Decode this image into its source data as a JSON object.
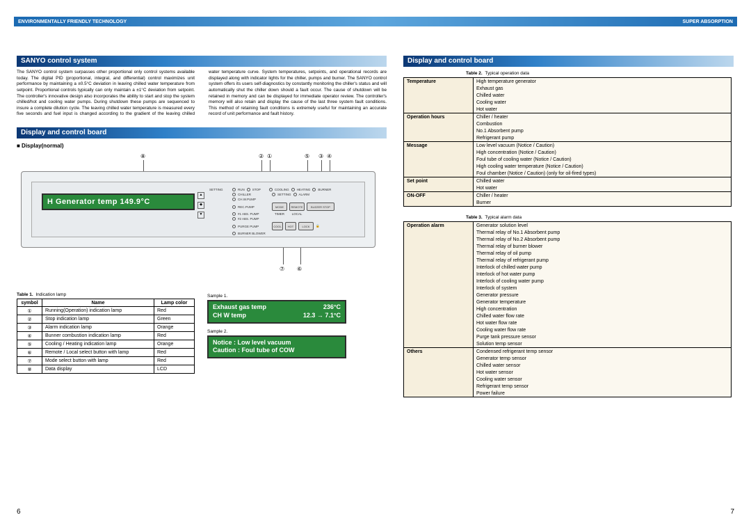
{
  "topbar": {
    "left": "ENVIRONMENTALLY FRIENDLY TECHNOLOGY",
    "right": "SUPER ABSORPTION"
  },
  "left": {
    "sec1_title": "SANYO control system",
    "body": "The SANYO control system surpasses other proportional only control systems available today. The digital PID (proportional, integral, and differential) control maximizes unit performance by maintaining a ±0.5°C deviation in leaving chilled water temperature from setpoint. Proportional controls typically can only maintain a ±1°C deviation from setpoint. The controller's innovative design also incorporates the ability to start and stop the system chilled/hot and cooling water pumps. During shutdown these pumps are sequenced to insure a complete dilution cycle. The leaving chilled water temperature is measured every five seconds and fuel input is changed according to the gradient of the leaving chilled water temperature curve. System temperatures, setpoints, and operational records are displayed along with indicator lights for the chiller, pumps and burner. The SANYO control system offers its users self-diagnostics by constantly monitoring the chiller's status and will automatically shut the chiller down should a fault occur. The cause of shutdown will be retained in memory and can be displayed for immediate operator review. The controller's memory will also retain and display the cause of the last three system fault conditions. This method of retaining fault conditions is extremely useful for maintaining an accurate record of unit performance and fault history.",
    "sec2_title": "Display and control board",
    "display_label": "■ Display(normal)",
    "lcd_main": "H Generator temp   149.9°C",
    "callouts": {
      "c8": "⑧",
      "c2": "②",
      "c1": "①",
      "c5": "⑤",
      "c3": "③",
      "c4": "④",
      "c7": "⑦",
      "c6": "⑥"
    },
    "ctrl_labels": {
      "setting": "SETTING",
      "run": "RUN",
      "stop": "STOP",
      "cooling": "COOLING",
      "heating": "HEATING",
      "burner": "BURNER",
      "chiller": "CHILLER",
      "setting2": "SETTING",
      "alarm": "ALARM",
      "chwpump": "CH.W.PUMP",
      "recpump": "REC.PUMP",
      "mode": "MODE",
      "remote": "REMOTE",
      "buzzer": "BUZZER STOP",
      "abs1": "#1 ABS. PUMP",
      "abs2": "#2 ABS. PUMP",
      "timer": "TIMER",
      "local": "LOCAL",
      "purge": "PURGE PUMP",
      "blower": "BURNER BLOWER",
      "cool": "COOL",
      "hot": "HOT",
      "lock": "LOCK"
    },
    "table1_caption_b": "Table 1.",
    "table1_caption": "Indication lamp",
    "table1_head": [
      "symbol",
      "Name",
      "Lamp color"
    ],
    "table1_rows": [
      [
        "①",
        "Running(Operation) indication lamp",
        "Red"
      ],
      [
        "②",
        "Stop indication lamp",
        "Green"
      ],
      [
        "③",
        "Alarm indication lamp",
        "Orange"
      ],
      [
        "④",
        "Bunner combustion indication lamp",
        "Red"
      ],
      [
        "⑤",
        "Cooling / Heating indication lamp",
        "Orange"
      ],
      [
        "⑥",
        "Remote / Local select button with lamp",
        "Red"
      ],
      [
        "⑦",
        "Mode select button with lamp",
        "Red"
      ],
      [
        "⑧",
        "Data display",
        "LCD"
      ]
    ],
    "sample1": "Sample 1.",
    "lcd_s1_l1a": "Exhaust gas temp",
    "lcd_s1_l1b": "236°C",
    "lcd_s1_l2a": "CH W temp",
    "lcd_s1_l2b": "12.3 → 7.1°C",
    "sample2": "Sample 2.",
    "lcd_s2_l1": "Notice : Low level vacuum",
    "lcd_s2_l2": "Caution : Foul tube of COW"
  },
  "right": {
    "sec_title": "Display and control board",
    "table2_caption_b": "Table 2.",
    "table2_caption": "Typical operation data",
    "table2": [
      {
        "k": "Temperature",
        "v": [
          "High temperature generator",
          "Exhaust gas",
          "Chilled water",
          "Cooling water",
          "Hot water"
        ]
      },
      {
        "k": "Operation hours",
        "v": [
          "Chiller / heater",
          "Combustion",
          "No.1 Absorbent pump",
          "Refrigerant pump"
        ]
      },
      {
        "k": "Message",
        "v": [
          "Low level vacuum (Notice / Caution)",
          "High concentration (Notice / Caution)",
          "Foul tube of cooling water (Notice / Caution)",
          "High cooling water temperature (Notice / Caution)",
          "Foul chamber (Notice / Caution) (only for oil-fired types)"
        ]
      },
      {
        "k": "Set point",
        "v": [
          "Chilled water",
          "Hot water"
        ]
      },
      {
        "k": "ON-OFF",
        "v": [
          "Chiller / heater",
          "Burner"
        ]
      }
    ],
    "table3_caption_b": "Table 3.",
    "table3_caption": "Typical alarm data",
    "table3": [
      {
        "k": "Operation alarm",
        "v": [
          "Generator solution level",
          "Thermal relay of No.1 Absorbent pump",
          "Thermal relay of No.2 Absorbent pump",
          "Thermal relay of burner blower",
          "Thermal relay of oil pump",
          "Thermal relay of refrigerant pump",
          "Interlock of chilled water pump",
          "Interlock of hot water pump",
          "Interlock of cooling water pump",
          "Interlock of system",
          "Generator pressure",
          "Generator temperature",
          "High concentration",
          "Chilled water flow rate",
          "Hot water flow rate",
          "Cooling water flow rate",
          "Purge tank pressure sensor",
          "Solution temp sensor"
        ]
      },
      {
        "k": "Others",
        "v": [
          "Condensed refrigerant temp sensor",
          "Generator temp sensor",
          "Chilled water sensor",
          "Hot water sensor",
          "Cooling water sensor",
          "Refrigerant temp sensor",
          "Power failure"
        ]
      }
    ]
  },
  "page_left": "6",
  "page_right": "7"
}
